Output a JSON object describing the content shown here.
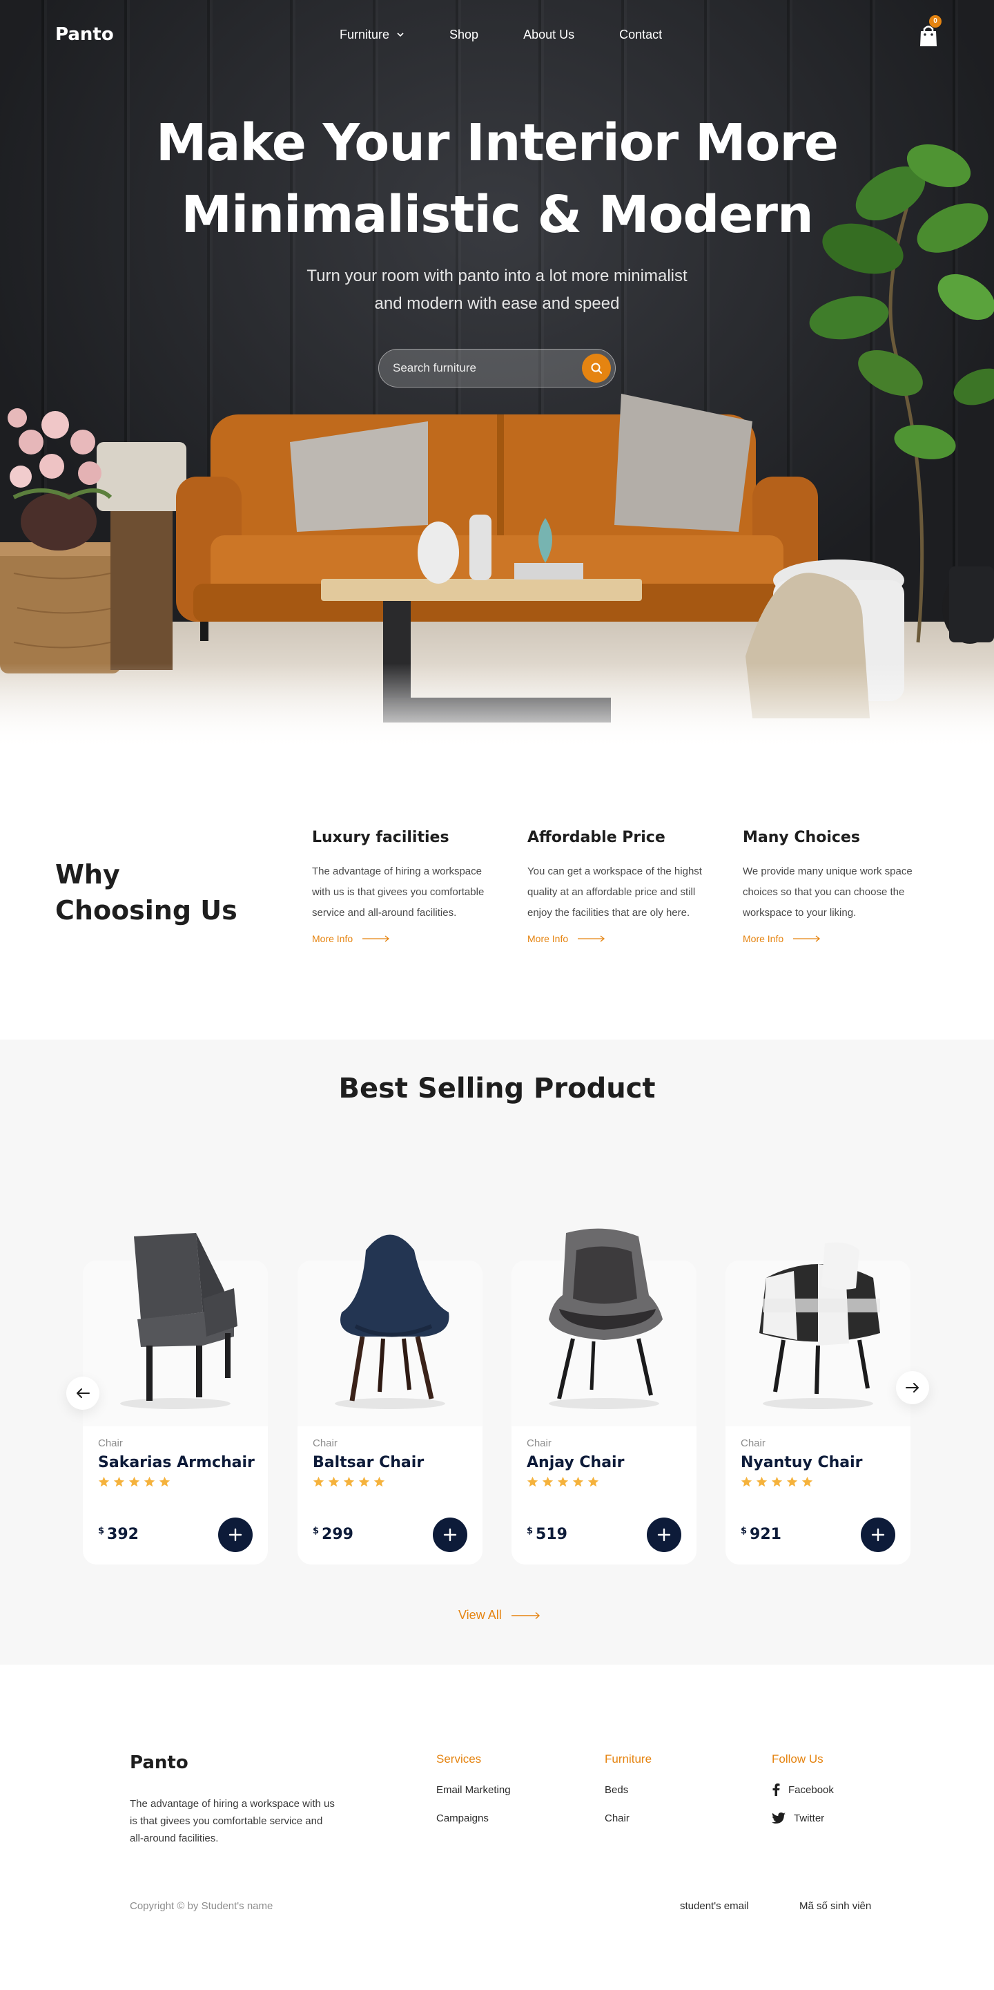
{
  "brand": {
    "name": "Panto",
    "accent": "#E58411",
    "navy": "#0D1B39"
  },
  "nav": {
    "items": [
      {
        "label": "Furniture",
        "has_dropdown": true
      },
      {
        "label": "Shop"
      },
      {
        "label": "About Us"
      },
      {
        "label": "Contact"
      }
    ],
    "cart_count": "0",
    "cart_icon": "shopping-bag-icon"
  },
  "hero": {
    "title_line1": "Make Your Interior More",
    "title_line2": "Minimalistic & Modern",
    "subtitle_line1": "Turn your room with panto into a lot more minimalist",
    "subtitle_line2": "and modern with ease and speed",
    "search_placeholder": "Search furniture",
    "search_icon": "search-icon"
  },
  "why": {
    "title_line1": "Why",
    "title_line2": "Choosing Us",
    "features": [
      {
        "title": "Luxury facilities",
        "text": "The advantage of hiring a workspace with us is that givees you comfortable service and all-around facilities.",
        "link": "More Info"
      },
      {
        "title": "Affordable Price",
        "text": "You can get a workspace of the highst quality at an affordable price and still enjoy the facilities that are oly here.",
        "link": "More Info"
      },
      {
        "title": "Many Choices",
        "text": "We provide many unique work space choices so that you can choose the workspace to your liking.",
        "link": "More Info"
      }
    ]
  },
  "products": {
    "title": "Best Selling Product",
    "currency": "$",
    "items": [
      {
        "category": "Chair",
        "name": "Sakarias Armchair",
        "rating": 5,
        "price": "392"
      },
      {
        "category": "Chair",
        "name": "Baltsar Chair",
        "rating": 5,
        "price": "299"
      },
      {
        "category": "Chair",
        "name": "Anjay Chair",
        "rating": 5,
        "price": "519"
      },
      {
        "category": "Chair",
        "name": "Nyantuy Chair",
        "rating": 5,
        "price": "921"
      }
    ],
    "view_all": "View All"
  },
  "footer": {
    "logo": "Panto",
    "description": "The advantage of hiring a workspace with us is that givees you comfortable service and all-around facilities.",
    "columns": [
      {
        "title": "Services",
        "links": [
          "Email Marketing",
          "Campaigns"
        ]
      },
      {
        "title": "Furniture",
        "links": [
          "Beds",
          "Chair"
        ]
      },
      {
        "title": "Follow Us",
        "links": [
          "Facebook",
          "Twitter"
        ]
      }
    ],
    "copyright": "Copyright © by Student's name",
    "email": "student's email",
    "student_id": "Mã số sinh viên"
  }
}
